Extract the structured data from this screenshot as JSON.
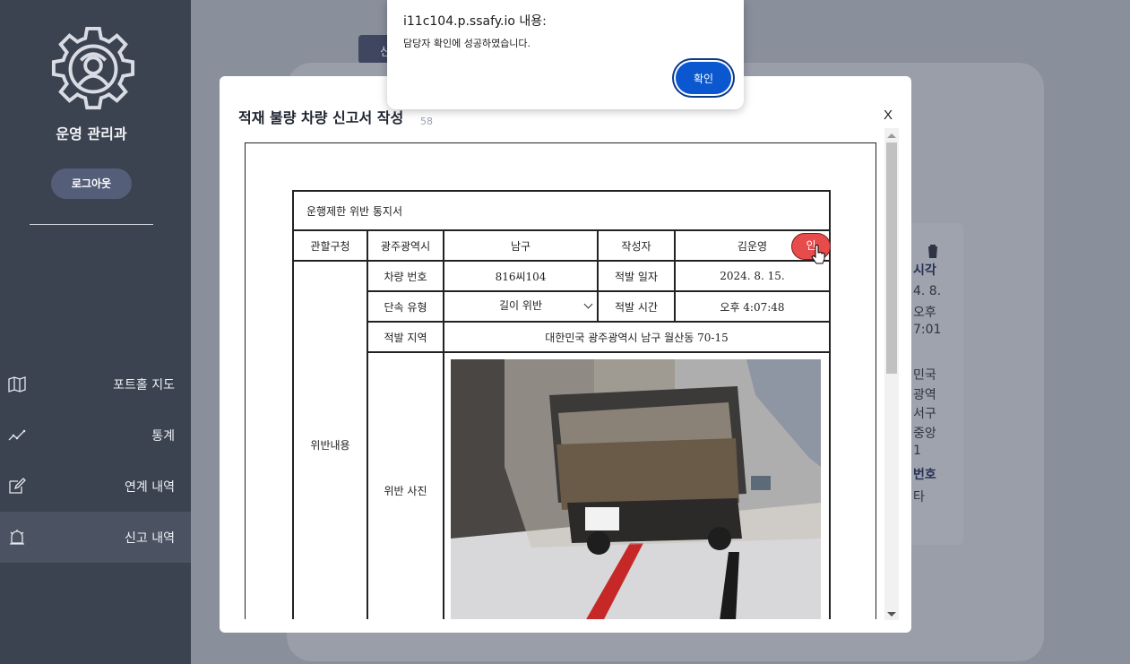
{
  "sidebar": {
    "org_name": "운영 관리과",
    "logout_label": "로그아웃",
    "nav": [
      {
        "label": "포트홀 지도",
        "icon": "map-icon"
      },
      {
        "label": "통계",
        "icon": "line-chart-icon"
      },
      {
        "label": "연계 내역",
        "icon": "edit-icon"
      },
      {
        "label": "신고 내역",
        "icon": "siren-icon",
        "active": true
      }
    ]
  },
  "background": {
    "tab_label": "신",
    "card": {
      "label_time": "시각",
      "date_part": "4. 8.",
      "ampm": "오후",
      "time_part": "7:01",
      "addr1": "민국",
      "addr2": "광역",
      "addr3": "서구",
      "addr4": "중앙",
      "addr5": "1",
      "label_number": "번호",
      "etc": "타"
    }
  },
  "modal": {
    "title": "적재 불량 차량 신고서 작성",
    "subtitle": "58",
    "close_label": "X",
    "document": {
      "heading": "운행제한 위반 통지서",
      "jurisdiction_label": "관할구청",
      "city": "광주광역시",
      "district": "남구",
      "author_label": "작성자",
      "author_name": "김운영",
      "confirm_label": "인",
      "violation_content_label": "위반내용",
      "vehicle_number_label": "차량 번호",
      "vehicle_number": "816씨104",
      "detect_date_label": "적발 일자",
      "detect_date": "2024. 8. 15.",
      "enforcement_type_label": "단속 유형",
      "enforcement_type": "길이 위반",
      "detect_time_label": "적발 시간",
      "detect_time": "오후 4:07:48",
      "detect_area_label": "적발 지역",
      "detect_area": "대한민국 광주광역시 남구 월산동 70-15",
      "violation_photo_label": "위반 사진"
    }
  },
  "alert": {
    "title": "i11c104.p.ssafy.io 내용:",
    "message": "담당자 확인에 성공하였습니다.",
    "ok_label": "확인"
  }
}
